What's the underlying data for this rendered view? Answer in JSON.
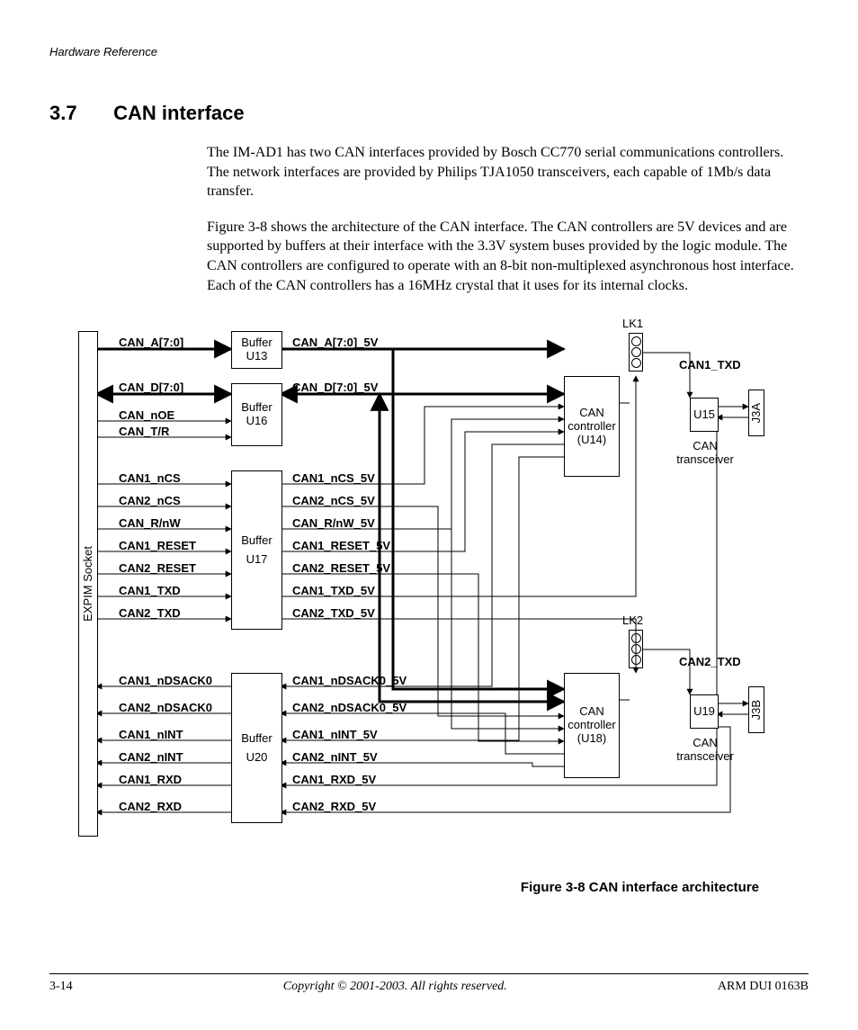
{
  "header": {
    "running_head": "Hardware Reference"
  },
  "section": {
    "number": "3.7",
    "title": "CAN interface",
    "para1": "The IM-AD1 has two CAN interfaces provided by Bosch CC770 serial communications controllers. The network interfaces are provided by Philips TJA1050 transceivers, each capable of 1Mb/s data transfer.",
    "para2": "Figure 3-8 shows the architecture of the CAN interface. The CAN controllers are 5V devices and are supported by buffers at their interface with the 3.3V system buses provided by the logic module. The CAN controllers are configured to operate with an 8-bit non-multiplexed asynchronous host interface. Each of the CAN controllers has a 16MHz crystal that it uses for its internal clocks."
  },
  "figure": {
    "caption": "Figure 3-8 CAN interface architecture",
    "socket_label": "EXPIM Socket",
    "buffers": {
      "u13": {
        "title": "Buffer",
        "ref": "U13"
      },
      "u16": {
        "title": "Buffer",
        "ref": "U16"
      },
      "u17": {
        "title": "Buffer",
        "ref": "U17"
      },
      "u20": {
        "title": "Buffer",
        "ref": "U20"
      }
    },
    "controllers": {
      "u14": {
        "line1": "CAN",
        "line2": "controller",
        "line3": "(U14)"
      },
      "u18": {
        "line1": "CAN",
        "line2": "controller",
        "line3": "(U18)"
      }
    },
    "transceivers": {
      "u15": {
        "ref": "U15",
        "label_l1": "CAN",
        "label_l2": "transceiver",
        "conn": "J3A"
      },
      "u19": {
        "ref": "U19",
        "label_l1": "CAN",
        "label_l2": "transceiver",
        "conn": "J3B"
      }
    },
    "jumpers": {
      "lk1": "LK1",
      "lk2": "LK2"
    },
    "tx_labels": {
      "can1": "CAN1_TXD",
      "can2": "CAN2_TXD"
    },
    "signals_left": {
      "can_a": "CAN_A[7:0]",
      "can_d": "CAN_D[7:0]",
      "can_noe": "CAN_nOE",
      "can_tr": "CAN_T/R",
      "can1_ncs": "CAN1_nCS",
      "can2_ncs": "CAN2_nCS",
      "can_rnw": "CAN_R/nW",
      "can1_reset": "CAN1_RESET",
      "can2_reset": "CAN2_RESET",
      "can1_txd": "CAN1_TXD",
      "can2_txd": "CAN2_TXD",
      "can1_ndsack0": "CAN1_nDSACK0",
      "can2_ndsack0": "CAN2_nDSACK0",
      "can1_nint": "CAN1_nINT",
      "can2_nint": "CAN2_nINT",
      "can1_rxd": "CAN1_RXD",
      "can2_rxd": "CAN2_RXD"
    },
    "signals_5v": {
      "can_a_5v": "CAN_A[7:0]_5V",
      "can_d_5v": "CAN_D[7:0]_5V",
      "can1_ncs_5v": "CAN1_nCS_5V",
      "can2_ncs_5v": "CAN2_nCS_5V",
      "can_rnw_5v": "CAN_R/nW_5V",
      "can1_reset_5v": "CAN1_RESET_5V",
      "can2_reset_5v": "CAN2_RESET_5V",
      "can1_txd_5v": "CAN1_TXD_5V",
      "can2_txd_5v": "CAN2_TXD_5V",
      "can1_ndsack0_5v": "CAN1_nDSACK0_5V",
      "can2_ndsack0_5v": "CAN2_nDSACK0_5V",
      "can1_nint_5v": "CAN1_nINT_5V",
      "can2_nint_5v": "CAN2_nINT_5V",
      "can1_rxd_5v": "CAN1_RXD_5V",
      "can2_rxd_5v": "CAN2_RXD_5V"
    }
  },
  "footer": {
    "page_num": "3-14",
    "copyright": "Copyright © 2001-2003. All rights reserved.",
    "doc_id": "ARM DUI 0163B"
  }
}
